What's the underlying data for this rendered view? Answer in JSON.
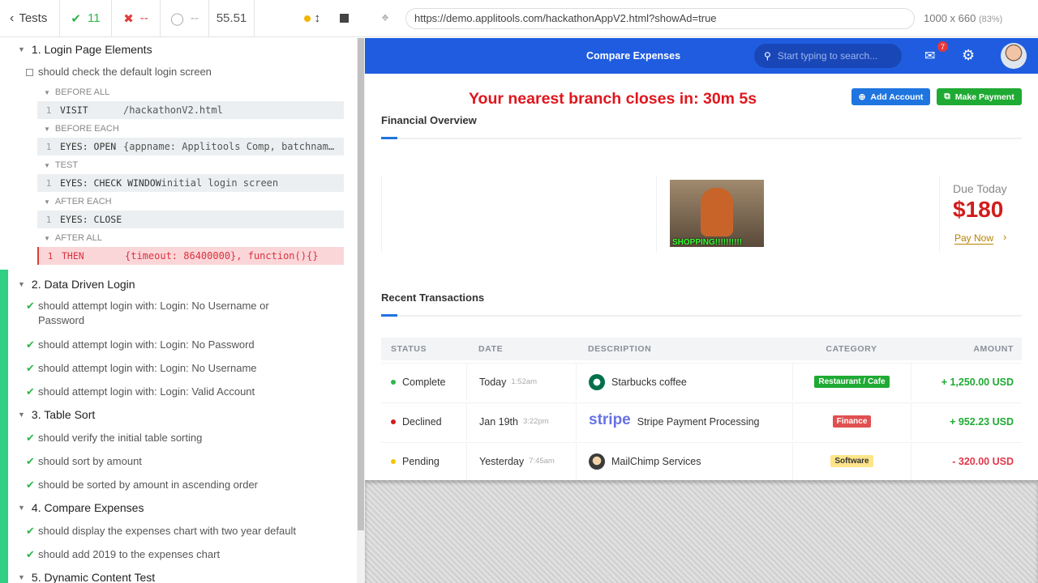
{
  "reporter": {
    "tests_label": "Tests",
    "passed": "11",
    "failed": "--",
    "pending": "--",
    "duration": "55.51",
    "suites": [
      {
        "title": "1. Login Page Elements"
      },
      {
        "title": "2. Data Driven Login"
      },
      {
        "title": "3. Table Sort"
      },
      {
        "title": "4. Compare Expenses"
      },
      {
        "title": "5. Dynamic Content Test"
      }
    ],
    "suite1_test": "should check the default login screen",
    "hooks": {
      "before_all": "BEFORE ALL",
      "before_each": "BEFORE EACH",
      "test": "TEST",
      "after_each": "AFTER EACH",
      "after_all": "AFTER ALL"
    },
    "commands": [
      {
        "num": "1",
        "name": "VISIT",
        "msg": "/hackathonV2.html"
      },
      {
        "num": "1",
        "name": "EYES: OPEN",
        "msg": "{appname: Applitools Comp, batchnam…"
      },
      {
        "num": "1",
        "name": "EYES: CHECK WINDOW",
        "msg": "initial login screen"
      },
      {
        "num": "1",
        "name": "EYES: CLOSE",
        "msg": ""
      },
      {
        "num": "1",
        "name": "THEN",
        "msg": "{timeout: 86400000}, function(){}"
      }
    ],
    "suite2_tests": [
      "should attempt login with: Login: No Username or Password",
      "should attempt login with: Login: No Password",
      "should attempt login with: Login: No Username",
      "should attempt login with: Login: Valid Account"
    ],
    "suite3_tests": [
      "should verify the initial table sorting",
      "should sort by amount",
      "should be sorted by amount in ascending order"
    ],
    "suite4_tests": [
      "should display the expenses chart with two year default",
      "should add 2019 to the expenses chart"
    ]
  },
  "aut_header": {
    "url": "https://demo.applitools.com/hackathonAppV2.html?showAd=true",
    "viewport": "1000 x 660",
    "scale": "(83%)"
  },
  "app": {
    "title": "Compare Expenses",
    "search_placeholder": "Start typing to search...",
    "notif_count": "7",
    "branch_message": "Your nearest branch closes in: 30m 5s",
    "add_account": "Add Account",
    "make_payment": "Make Payment",
    "financial_overview": "Financial Overview",
    "ad_text": "SHOPPING!!!!!!!!!!",
    "due_label": "Due Today",
    "due_amount": "$180",
    "pay_now": "Pay Now",
    "recent_transactions": "Recent Transactions",
    "columns": [
      "STATUS",
      "DATE",
      "DESCRIPTION",
      "CATEGORY",
      "AMOUNT"
    ],
    "rows": [
      {
        "status": "Complete",
        "status_color": "#2fb64b",
        "date": "Today",
        "time": "1:52am",
        "description": "Starbucks coffee",
        "logo": "starbucks-logo",
        "category": "Restaurant / Cafe",
        "category_color": "#1faa33",
        "amount": "+ 1,250.00 USD",
        "amount_color": "#1faa33"
      },
      {
        "status": "Declined",
        "status_color": "#d31c1c",
        "date": "Jan 19th",
        "time": "3:22pm",
        "description": "Stripe Payment Processing",
        "logo": "stripe-logo",
        "category": "Finance",
        "category_color": "#e05050",
        "amount": "+ 952.23 USD",
        "amount_color": "#1faa33"
      },
      {
        "status": "Pending",
        "status_color": "#f5c400",
        "date": "Yesterday",
        "time": "7:45am",
        "description": "MailChimp Services",
        "logo": "mailchimp-logo",
        "category": "Software",
        "category_color": "#ffe58a",
        "amount": "- 320.00 USD",
        "amount_color": "#e0384b"
      }
    ]
  }
}
